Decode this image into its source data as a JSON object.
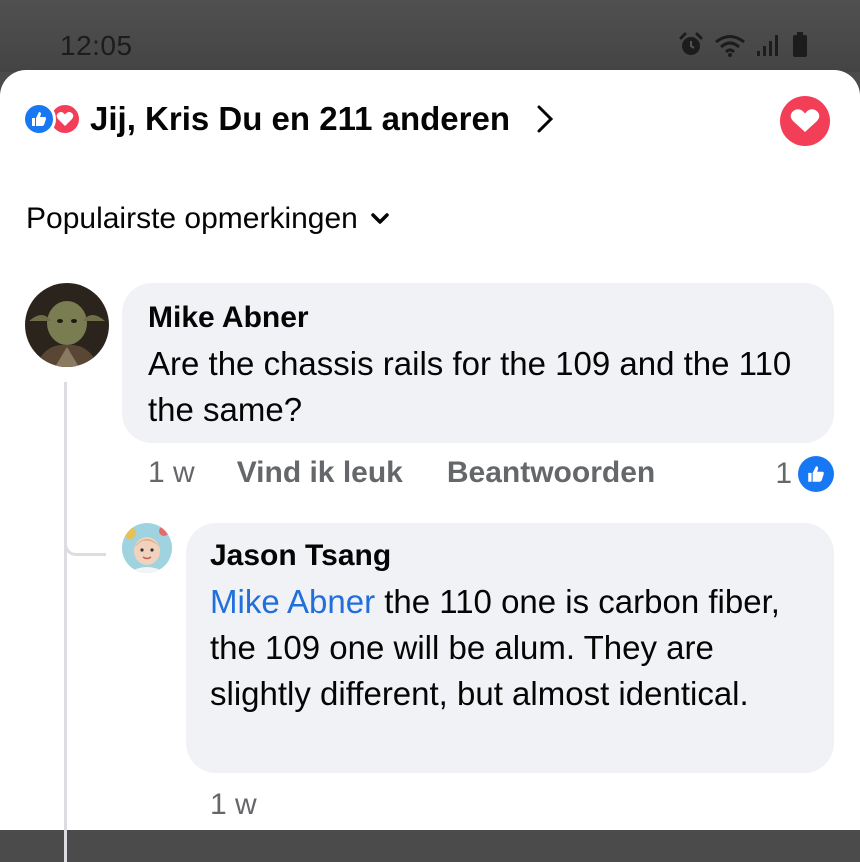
{
  "status_bar": {
    "time": "12:05",
    "icons": [
      "alarm-icon",
      "wifi-icon",
      "signal-icon",
      "battery-icon"
    ]
  },
  "reactions": {
    "summary": "Jij, Kris Du en 211 anderen",
    "icons": [
      "like-icon",
      "love-icon"
    ]
  },
  "sort": {
    "label": "Populairste opmerkingen"
  },
  "comments": [
    {
      "author": "Mike Abner",
      "text": "Are the chassis rails for the 109 and the 110 the same?",
      "time": "1 w",
      "like_label": "Vind ik leuk",
      "reply_label": "Beantwoorden",
      "reaction_count": "1"
    }
  ],
  "replies": [
    {
      "author": "Jason Tsang",
      "mention": "Mike Abner",
      "text": " the 110 one is carbon fiber, the 109 one will be alum. They are slightly different, but almost identical.",
      "time": "1 w"
    }
  ],
  "colors": {
    "like_blue": "#1877f2",
    "love_red": "#f33e58",
    "mention_blue": "#216fdb",
    "bubble_bg": "#f0f2f5",
    "meta_gray": "#65676b"
  }
}
